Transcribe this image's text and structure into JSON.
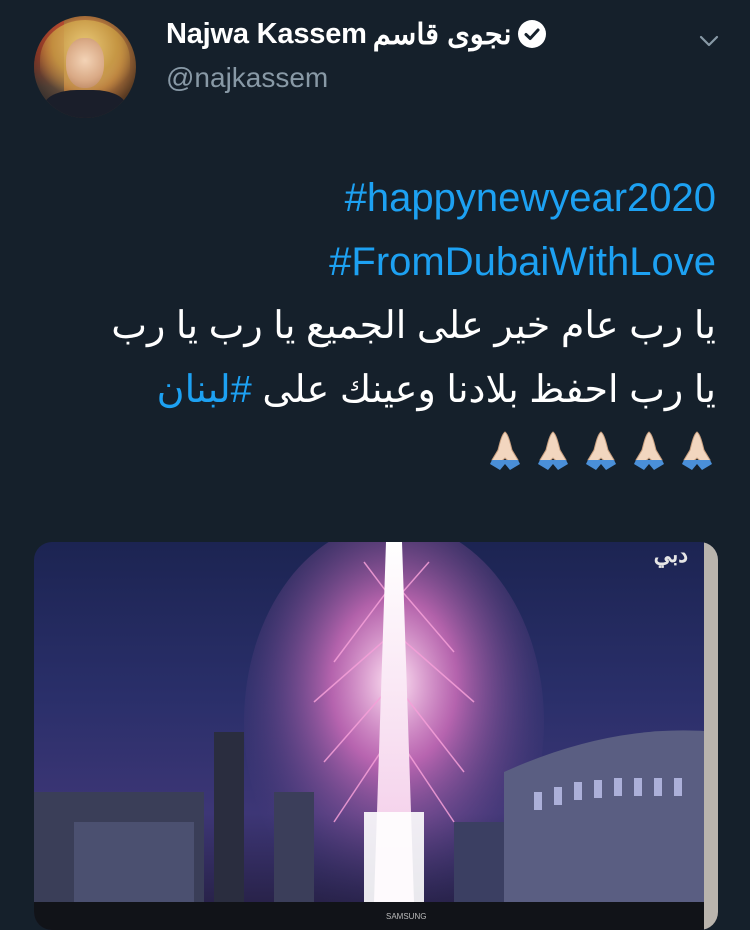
{
  "tweet": {
    "display_name": "Najwa Kassem",
    "display_name_arabic": "نجوى قاسم",
    "handle": "@najkassem",
    "hashtag1": "#happynewyear2020",
    "hashtag2": "#FromDubaiWithLove",
    "line1": "يا رب عام خير على الجميع يا رب يا رب",
    "line2_text": "يا رب احفظ بلادنا وعينك على ",
    "line2_tag": "#لبنان",
    "emoji": "🙏🏻🙏🏻🙏🏻🙏🏻🙏🏻"
  },
  "media": {
    "tv_channel_logo": "دبي",
    "tv_brand": "SAMSUNG"
  },
  "icons": {
    "verified": "verified-badge-icon",
    "menu": "chevron-down-icon",
    "prayer": "folded-hands-icon"
  },
  "colors": {
    "background": "#15202b",
    "link": "#1da1f2",
    "secondary_text": "#8899a6"
  }
}
